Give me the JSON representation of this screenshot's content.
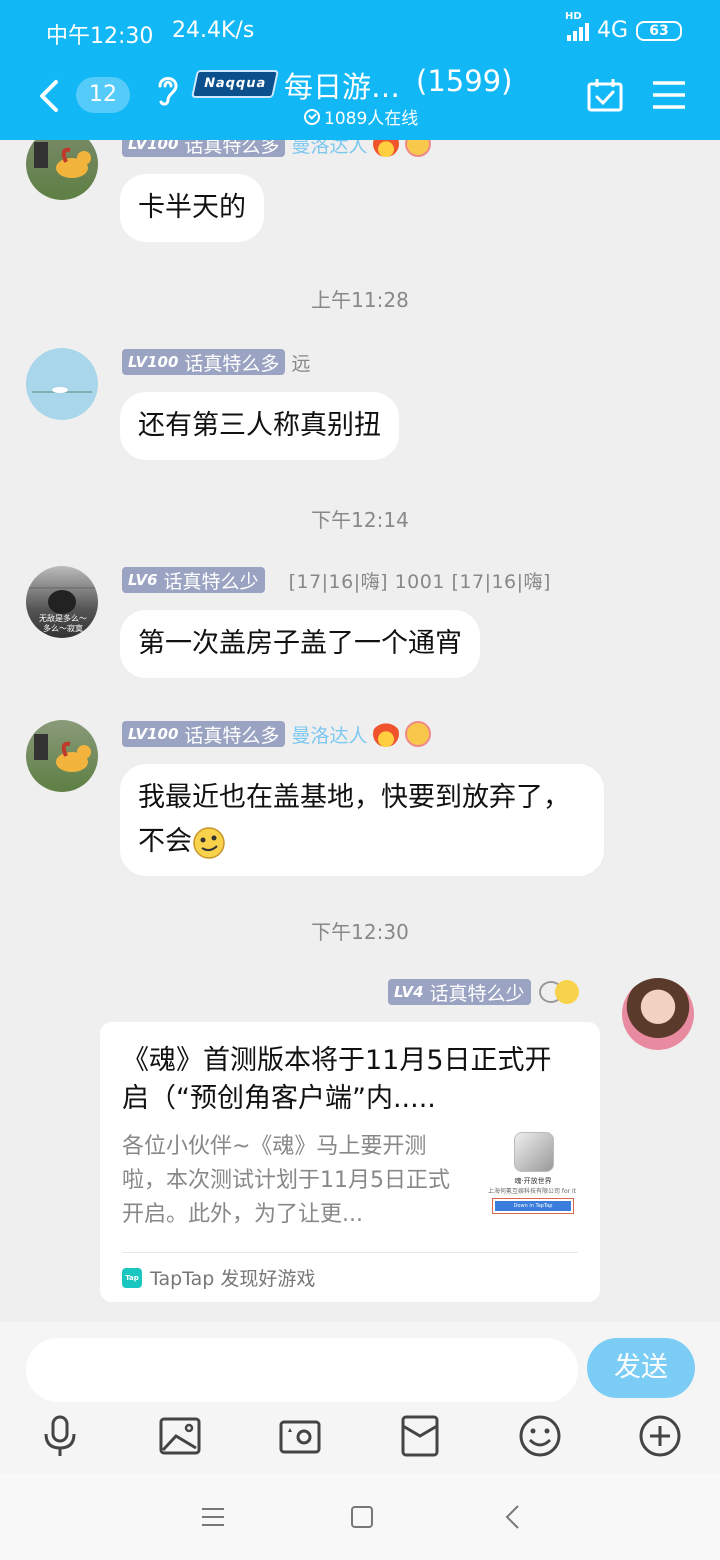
{
  "status_bar": {
    "time": "中午12:30",
    "speed": "24.4K/s",
    "network": "4G",
    "hd": "HD",
    "battery": "63"
  },
  "header": {
    "unread": "12",
    "logo_text": "Naqqua",
    "group_name": "每日游…",
    "member_count": "(1599)",
    "online": "1089人在线"
  },
  "messages": [
    {
      "level": "LV100",
      "title": "话真特么多",
      "nickname": "曼洛达人",
      "text": "卡半天的"
    },
    {
      "timestamp": "上午11:28"
    },
    {
      "level": "LV100",
      "title": "话真特么多",
      "nickname": "远",
      "text": "还有第三人称真别扭"
    },
    {
      "timestamp": "下午12:14"
    },
    {
      "level": "LV6",
      "title": "话真特么少",
      "extra": "[17|16|嗨]    1001    [17|16|嗨]",
      "avatar_caption": "无敌是多么～多么～寂寞",
      "text": "第一次盖房子盖了一个通宵"
    },
    {
      "level": "LV100",
      "title": "话真特么多",
      "nickname": "曼洛达人",
      "text": "我最近也在盖基地，快要到放弃了，不会"
    },
    {
      "timestamp": "下午12:30"
    },
    {
      "level": "LV4",
      "title": "话真特么少"
    }
  ],
  "share_card": {
    "title": "《魂》首测版本将于11月5日正式开启（“预创角客户端”内.....",
    "description": "各位小伙伴~《魂》马上要开测啦，本次测试计划于11月5日正式开启。此外，为了让更...",
    "thumb_title": "魂·开放世界",
    "thumb_company": "上海何氪互娱科技有限公司 for it",
    "thumb_button": "Down in TapTap",
    "source": "TapTap 发现好游戏",
    "source_icon_text": "Tap"
  },
  "input": {
    "placeholder": "",
    "send_label": "发送"
  },
  "colors": {
    "header": "#12b7f5",
    "send": "#7bcdf6",
    "level_badge": "#9aa3c2"
  },
  "icons": [
    "mic-icon",
    "image-icon",
    "camera-icon",
    "red-packet-icon",
    "emoji-icon",
    "plus-icon"
  ]
}
